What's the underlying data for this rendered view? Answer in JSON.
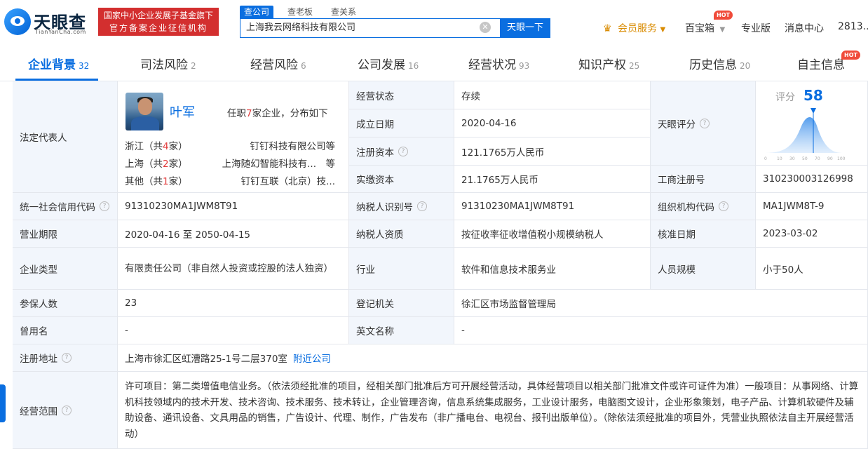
{
  "header": {
    "logo_text": "天眼查",
    "logo_sub": "TianYanCha.com",
    "badge_line1": "国家中小企业发展子基金旗下",
    "badge_line2": "官方备案企业征信机构",
    "search_tabs": [
      "查公司",
      "查老板",
      "查关系"
    ],
    "search_value": "上海我云网络科技有限公司",
    "search_button": "天眼一下",
    "vip": "会员服务",
    "baobao": "百宝箱",
    "pro": "专业版",
    "msg": "消息中心",
    "user": "2813...",
    "hot": "HOT"
  },
  "tabs": [
    {
      "label": "企业背景",
      "count": "32"
    },
    {
      "label": "司法风险",
      "count": "2"
    },
    {
      "label": "经营风险",
      "count": "6"
    },
    {
      "label": "公司发展",
      "count": "16"
    },
    {
      "label": "经营状况",
      "count": "93"
    },
    {
      "label": "知识产权",
      "count": "25"
    },
    {
      "label": "历史信息",
      "count": "20"
    },
    {
      "label": "自主信息",
      "count": ""
    }
  ],
  "rep": {
    "label": "法定代表人",
    "name": "叶军",
    "info_pre": "任职",
    "info_num": "7",
    "info_post": "家企业，分布如下",
    "rows": [
      {
        "region": "浙江（共",
        "num": "4",
        "suffix": "家）",
        "company": "钉钉科技有限公司等"
      },
      {
        "region": "上海（共",
        "num": "2",
        "suffix": "家）",
        "company": "上海随幻智能科技有...　等"
      },
      {
        "region": "其他（共",
        "num": "1",
        "suffix": "家）",
        "company": "钉钉互联（北京）技..."
      }
    ]
  },
  "score": {
    "label": "天眼评分",
    "title": "评分",
    "value": "58",
    "ticks": [
      "0",
      "10",
      "30",
      "50",
      "70",
      "90",
      "100"
    ]
  },
  "fields": {
    "status_l": "经营状态",
    "status_v": "存续",
    "found_l": "成立日期",
    "found_v": "2020-04-16",
    "reg_cap_l": "注册资本",
    "reg_cap_v": "121.1765万人民币",
    "paid_cap_l": "实缴资本",
    "paid_cap_v": "21.1765万人民币",
    "biz_reg_l": "工商注册号",
    "biz_reg_v": "310230003126998",
    "credit_l": "统一社会信用代码",
    "credit_v": "91310230MA1JWM8T91",
    "taxid_l": "纳税人识别号",
    "taxid_v": "91310230MA1JWM8T91",
    "org_l": "组织机构代码",
    "org_v": "MA1JWM8T-9",
    "term_l": "营业期限",
    "term_v": "2020-04-16 至 2050-04-15",
    "taxq_l": "纳税人资质",
    "taxq_v": "按征收率征收增值税小规模纳税人",
    "approve_l": "核准日期",
    "approve_v": "2023-03-02",
    "type_l": "企业类型",
    "type_v": "有限责任公司（非自然人投资或控股的法人独资）",
    "industry_l": "行业",
    "industry_v": "软件和信息技术服务业",
    "staff_l": "人员规模",
    "staff_v": "小于50人",
    "insured_l": "参保人数",
    "insured_v": "23",
    "authority_l": "登记机关",
    "authority_v": "徐汇区市场监督管理局",
    "former_l": "曾用名",
    "former_v": "-",
    "en_l": "英文名称",
    "en_v": "-",
    "addr_l": "注册地址",
    "addr_v": "上海市徐汇区虹漕路25-1号二层370室",
    "addr_link": "附近公司",
    "scope_l": "经营范围",
    "scope_v": "许可项目：第二类增值电信业务。（依法须经批准的项目，经相关部门批准后方可开展经营活动，具体经营项目以相关部门批准文件或许可证件为准）一般项目：从事网络、计算机科技领域内的技术开发、技术咨询、技术服务、技术转让，企业管理咨询，信息系统集成服务，工业设计服务，电脑图文设计，企业形象策划，电子产品、计算机软硬件及辅助设备、通讯设备、文具用品的销售，广告设计、代理、制作，广告发布（非广播电台、电视台、报刊出版单位）。（除依法须经批准的项目外，凭营业执照依法自主开展经营活动）"
  },
  "colors": {
    "accent": "#0a6ee0",
    "label_bg": "#f2f6fc",
    "red": "#d32f2f"
  }
}
